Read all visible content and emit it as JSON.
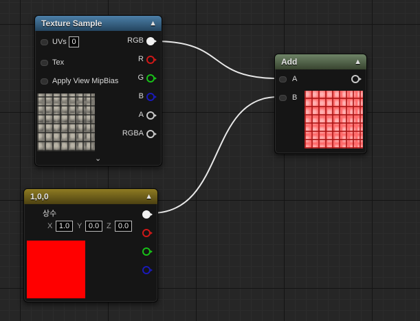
{
  "texture_sample": {
    "title": "Texture Sample",
    "inputs": {
      "uvs_label": "UVs",
      "uvs_value": "0",
      "tex_label": "Tex",
      "mipbias_label": "Apply View MipBias"
    },
    "outputs": [
      "RGB",
      "R",
      "G",
      "B",
      "A",
      "RGBA"
    ]
  },
  "add_node": {
    "title": "Add",
    "inputs": [
      "A",
      "B"
    ]
  },
  "constant_node": {
    "title": "1,0,0",
    "label": "상수",
    "x_label": "X",
    "x_value": "1.0",
    "y_label": "Y",
    "y_value": "0.0",
    "z_label": "Z",
    "z_value": "0.0"
  },
  "colors": {
    "header_texture": "#356688",
    "header_add": "#52644c",
    "header_constant": "#6e5f1a",
    "constant_swatch": "#ff0000",
    "pin_r": "#d01818",
    "pin_g": "#18c018",
    "pin_b": "#1a1ab8"
  },
  "icons": [
    "collapse-chevron-up-icon",
    "expand-chevron-down-icon",
    "pin-icon"
  ]
}
